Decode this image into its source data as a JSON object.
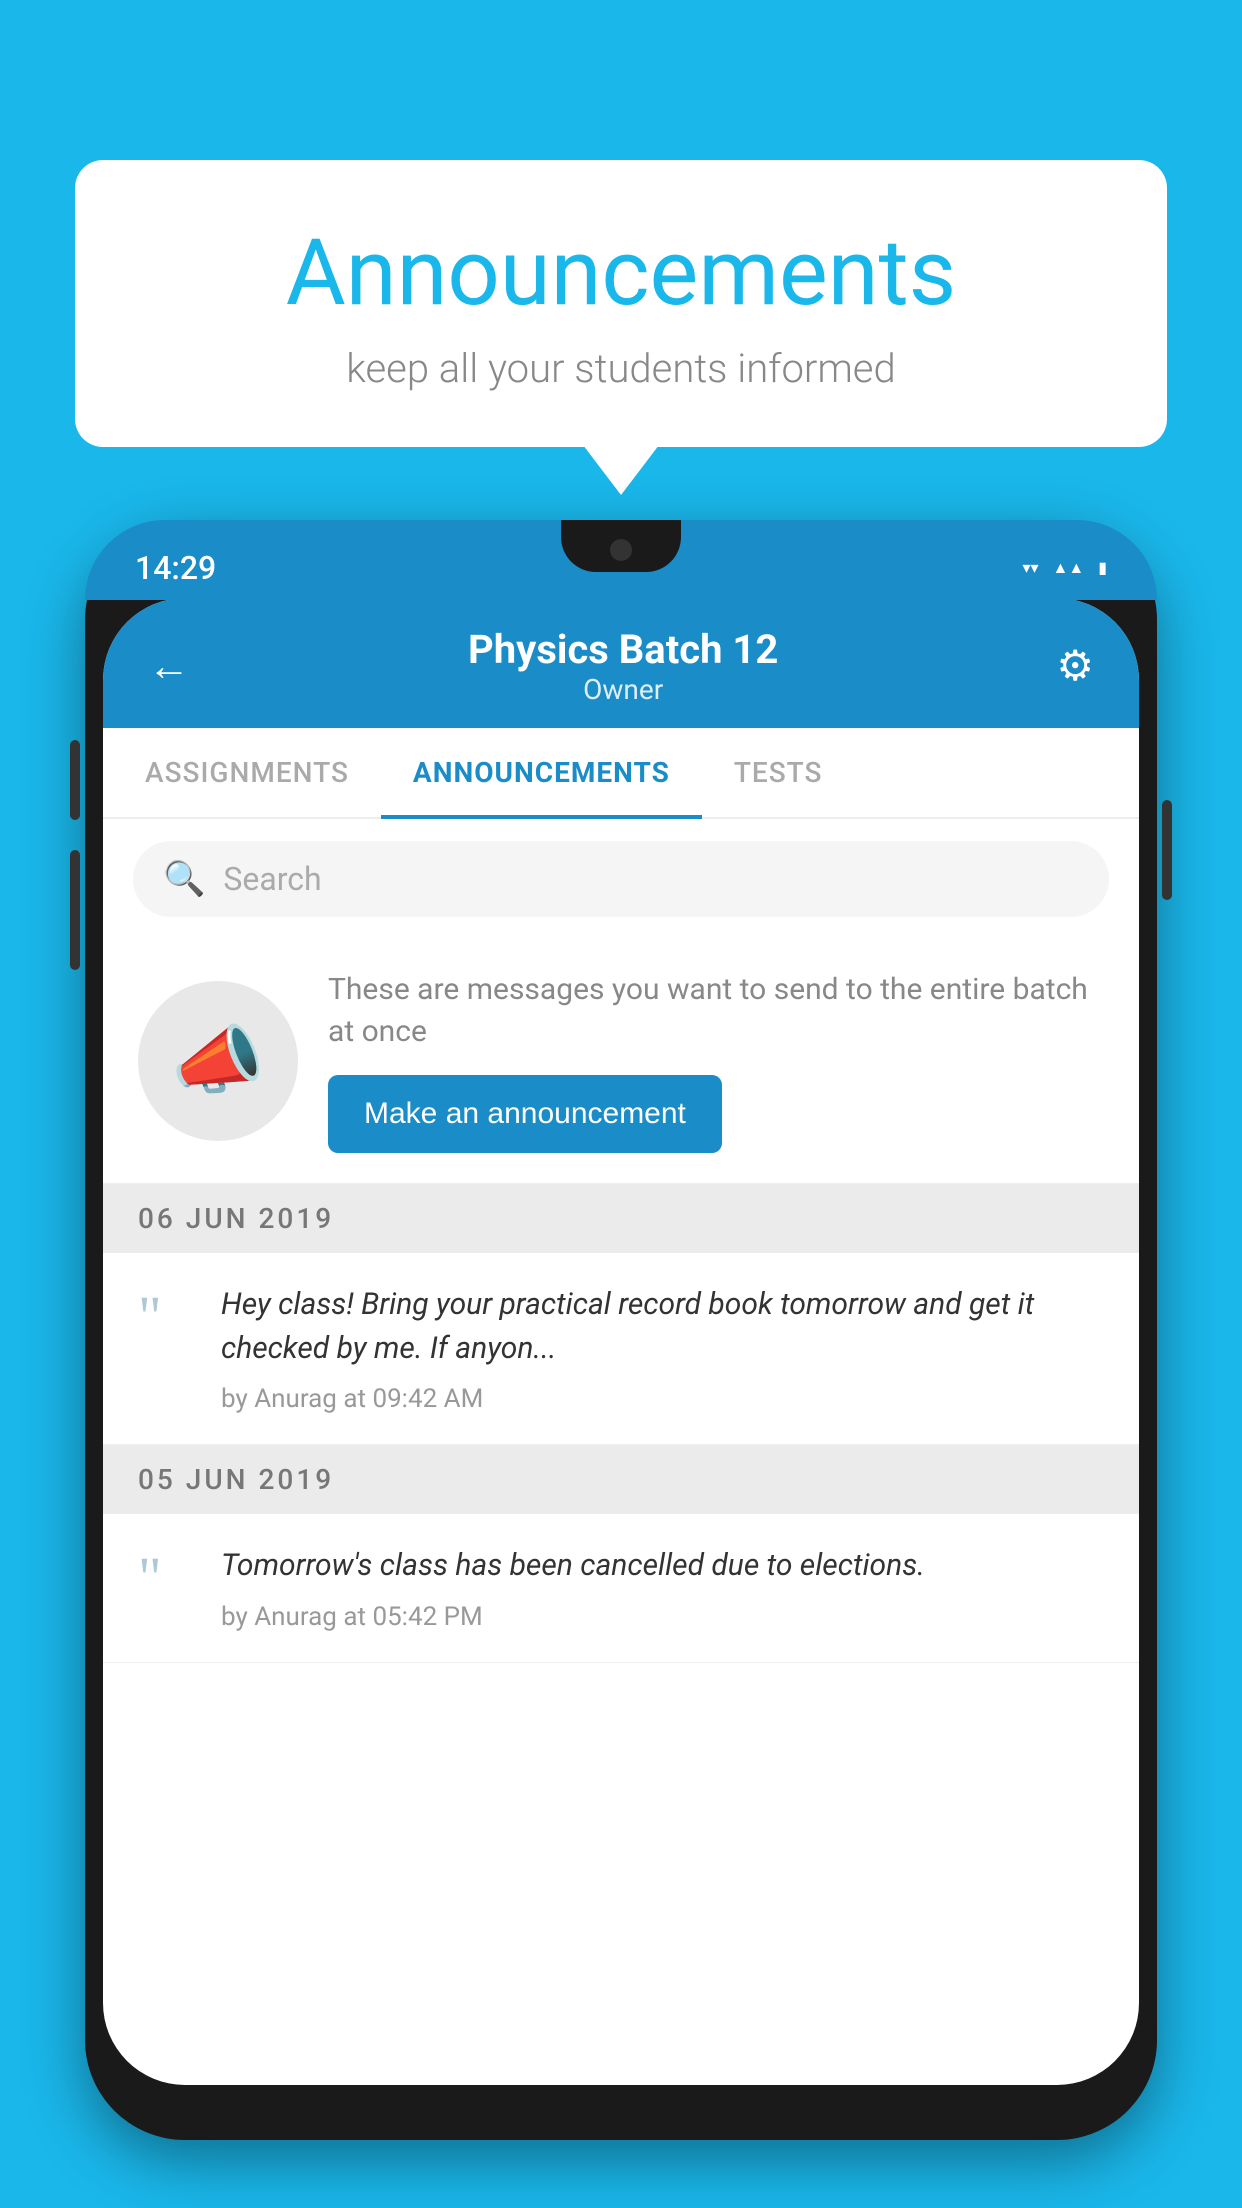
{
  "background_color": "#1ab7ea",
  "speech_bubble": {
    "title": "Announcements",
    "subtitle": "keep all your students informed"
  },
  "status_bar": {
    "time": "14:29",
    "icons": [
      "wifi",
      "signal",
      "battery"
    ]
  },
  "app_header": {
    "back_label": "←",
    "title": "Physics Batch 12",
    "subtitle": "Owner",
    "gear_label": "⚙"
  },
  "tabs": [
    {
      "label": "ASSIGNMENTS",
      "active": false
    },
    {
      "label": "ANNOUNCEMENTS",
      "active": true
    },
    {
      "label": "TESTS",
      "active": false
    },
    {
      "label": "...",
      "active": false
    }
  ],
  "search": {
    "placeholder": "Search"
  },
  "announcement_prompt": {
    "description_text": "These are messages you want to send to the entire batch at once",
    "button_label": "Make an announcement"
  },
  "date_dividers": [
    {
      "date": "06  JUN  2019"
    },
    {
      "date": "05  JUN  2019"
    }
  ],
  "announcements": [
    {
      "text": "Hey class! Bring your practical record book tomorrow and get it checked by me. If anyon...",
      "meta": "by Anurag at 09:42 AM"
    },
    {
      "text": "Tomorrow's class has been cancelled due to elections.",
      "meta": "by Anurag at 05:42 PM"
    }
  ]
}
